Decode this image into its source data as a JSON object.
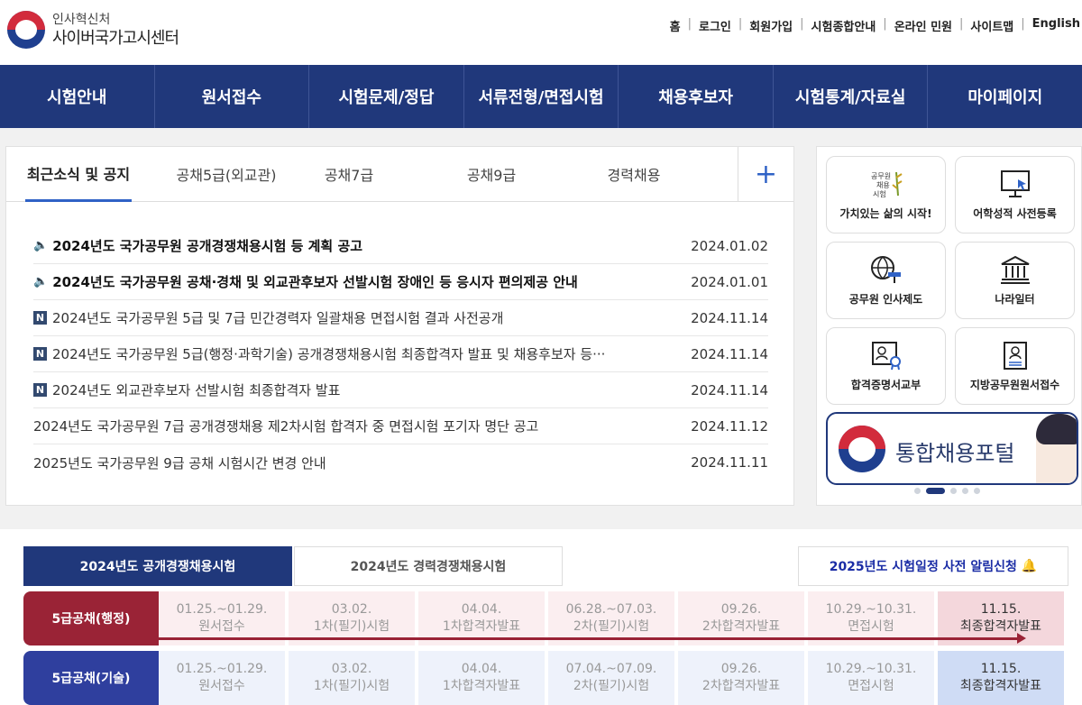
{
  "header": {
    "org": "인사혁신처",
    "site_name": "사이버국가고시센터",
    "util_links": [
      "홈",
      "로그인",
      "회원가입",
      "시험종합안내",
      "온라인 민원",
      "사이트맵",
      "English"
    ]
  },
  "nav": [
    "시험안내",
    "원서접수",
    "시험문제/정답",
    "서류전형/면접시험",
    "채용후보자",
    "시험통계/자료실",
    "마이페이지"
  ],
  "news": {
    "tabs": [
      "최근소식 및 공지",
      "공채5급(외교관)",
      "공채7급",
      "공채9급",
      "경력채용"
    ],
    "more_icon": "plus-icon",
    "items": [
      {
        "title": "2024년도 국가공무원 공개경쟁채용시험 등 계획 공고",
        "date": "2024.01.02",
        "type": "notice"
      },
      {
        "title": "2024년도 국가공무원 공채·경채 및 외교관후보자 선발시험 장애인 등 응시자 편의제공 안내",
        "date": "2024.01.01",
        "type": "notice"
      },
      {
        "title": "2024년도 국가공무원 5급 및 7급 민간경력자 일괄채용 면접시험 결과 사전공개",
        "date": "2024.11.14",
        "type": "new"
      },
      {
        "title": "2024년도 국가공무원 5급(행정·과학기술) 공개경쟁채용시험 최종합격자 발표 및 채용후보자 등···",
        "date": "2024.11.14",
        "type": "new"
      },
      {
        "title": "2024년도 외교관후보자 선발시험 최종합격자 발표",
        "date": "2024.11.14",
        "type": "new"
      },
      {
        "title": "2024년도 국가공무원 7급 공개경쟁채용 제2차시험 합격자 중 면접시험 포기자 명단 공고",
        "date": "2024.11.12",
        "type": "plain"
      },
      {
        "title": "2025년도 국가공무원 9급 공채 시험시간 변경 안내",
        "date": "2024.11.11",
        "type": "plain"
      }
    ],
    "badge_n": "N"
  },
  "side": {
    "cards": [
      {
        "label": "가치있는 삶의 시작!",
        "icon": "civil-service-logo-icon"
      },
      {
        "label": "어학성적 사전등록",
        "icon": "monitor-cursor-icon"
      },
      {
        "label": "공무원 인사제도",
        "icon": "globe-gavel-icon"
      },
      {
        "label": "나라일터",
        "icon": "building-icon"
      },
      {
        "label": "합격증명서교부",
        "icon": "certificate-icon"
      },
      {
        "label": "지방공무원원서접수",
        "icon": "document-person-icon"
      }
    ],
    "card1_logo_text": "공무원 채용 시험",
    "banner_text": "통합채용포털",
    "slides": 5,
    "active_slide": 2
  },
  "schedule": {
    "tabs": [
      "2024년도 공개경쟁채용시험",
      "2024년도 경력경쟁채용시험"
    ],
    "notify": "2025년도 시험일정 사전 알림신청",
    "rows": [
      {
        "label": "5급공채(행정)",
        "color": "#9a2336",
        "cell_bg": "#fbeef0",
        "final_bg": "#f4d7dc",
        "cells": [
          [
            "01.25.~01.29.",
            "원서접수"
          ],
          [
            "03.02.",
            "1차(필기)시험"
          ],
          [
            "04.04.",
            "1차합격자발표"
          ],
          [
            "06.28.~07.03.",
            "2차(필기)시험"
          ],
          [
            "09.26.",
            "2차합격자발표"
          ],
          [
            "10.29.~10.31.",
            "면접시험"
          ],
          [
            "11.15.",
            "최종합격자발표"
          ]
        ]
      },
      {
        "label": "5급공채(기술)",
        "color": "#2f3f9e",
        "cell_bg": "#eef2fb",
        "final_bg": "#cfdcf5",
        "cells": [
          [
            "01.25.~01.29.",
            "원서접수"
          ],
          [
            "03.02.",
            "1차(필기)시험"
          ],
          [
            "04.04.",
            "1차합격자발표"
          ],
          [
            "07.04.~07.09.",
            "2차(필기)시험"
          ],
          [
            "09.26.",
            "2차합격자발표"
          ],
          [
            "10.29.~10.31.",
            "면접시험"
          ],
          [
            "11.15.",
            "최종합격자발표"
          ]
        ]
      }
    ]
  },
  "colors": {
    "nav_bg": "#20387b",
    "accent": "#2f62c6"
  }
}
